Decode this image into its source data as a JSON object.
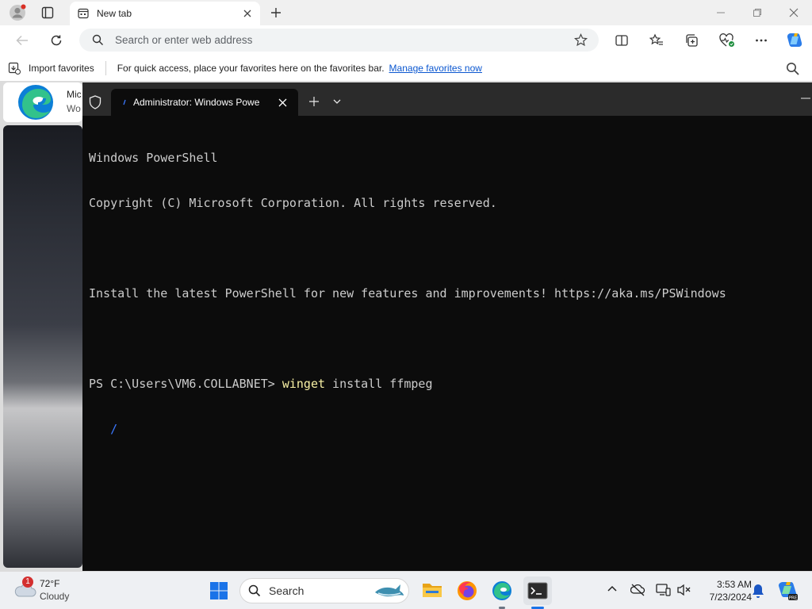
{
  "browser": {
    "tab_title": "New tab",
    "address_placeholder": "Search or enter web address",
    "favorites_bar": {
      "import_label": "Import favorites",
      "hint_text": "For quick access, place your favorites here on the favorites bar.",
      "manage_link": "Manage favorites now"
    },
    "page": {
      "card_text_1": "Mic",
      "card_text_2": "Wo"
    }
  },
  "terminal": {
    "tab_title": "Administrator: Windows Powe",
    "lines": [
      "Windows PowerShell",
      "Copyright (C) Microsoft Corporation. All rights reserved.",
      "",
      "Install the latest PowerShell for new features and improvements! https://aka.ms/PSWindows",
      ""
    ],
    "prompt": "PS C:\\Users\\VM6.COLLABNET> ",
    "command": "winget",
    "command_args": " install ffmpeg",
    "spinner": "   /"
  },
  "taskbar": {
    "weather_temp": "72°F",
    "weather_desc": "Cloudy",
    "weather_badge": "1",
    "search_label": "Search",
    "time": "3:53 AM",
    "date": "7/23/2024"
  },
  "colors": {
    "terminal_bg": "#0c0c0c",
    "terminal_text": "#cccccc",
    "command_text": "#f9f1a5",
    "spinner": "#3b78ff",
    "link": "#0b57d0"
  }
}
